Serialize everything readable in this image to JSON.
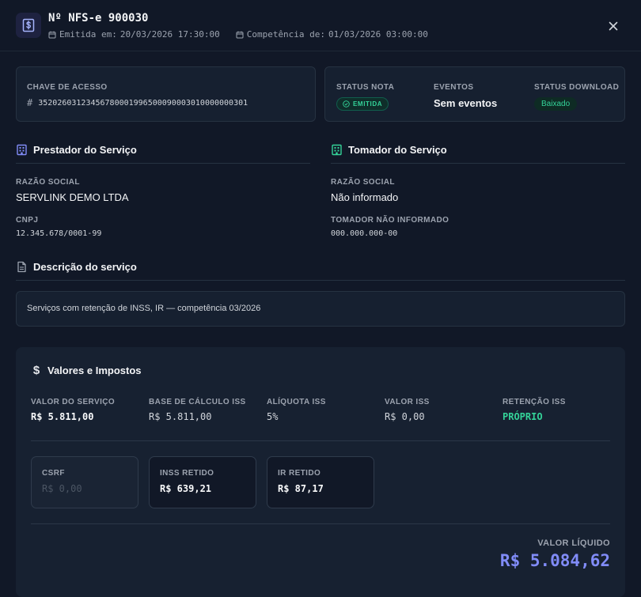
{
  "header": {
    "title": "Nº NFS-e 900030",
    "emitida_label": "Emitida em:",
    "emitida_value": "20/03/2026 17:30:00",
    "competencia_label": "Competência de:",
    "competencia_value": "01/03/2026 03:00:00"
  },
  "access": {
    "label": "CHAVE DE ACESSO",
    "key": "35202603123456780001996500090003010000000301"
  },
  "status": {
    "nota_label": "STATUS NOTA",
    "nota_value": "EMITIDA",
    "eventos_label": "EVENTOS",
    "eventos_value": "Sem eventos",
    "download_label": "STATUS DOWNLOAD",
    "download_value": "Baixado"
  },
  "prestador": {
    "title": "Prestador do Serviço",
    "razao_label": "RAZÃO SOCIAL",
    "razao_value": "SERVLINK DEMO LTDA",
    "cnpj_label": "CNPJ",
    "cnpj_value": "12.345.678/0001-99"
  },
  "tomador": {
    "title": "Tomador do Serviço",
    "razao_label": "RAZÃO SOCIAL",
    "razao_value": "Não informado",
    "doc_label": "TOMADOR NÃO INFORMADO",
    "doc_value": "000.000.000-00"
  },
  "descricao": {
    "title": "Descrição do serviço",
    "text": "Serviços com retenção de INSS, IR — competência 03/2026"
  },
  "valores": {
    "title": "Valores e Impostos",
    "items": [
      {
        "label": "VALOR DO SERVIÇO",
        "value": "R$ 5.811,00"
      },
      {
        "label": "BASE DE CÁLCULO ISS",
        "value": "R$ 5.811,00"
      },
      {
        "label": "ALÍQUOTA ISS",
        "value": "5%"
      },
      {
        "label": "VALOR ISS",
        "value": "R$ 0,00"
      },
      {
        "label": "RETENÇÃO ISS",
        "value": "PRÓPRIO"
      }
    ],
    "taxes": [
      {
        "label": "CSRF",
        "value": "R$ 0,00"
      },
      {
        "label": "INSS RETIDO",
        "value": "R$ 639,21"
      },
      {
        "label": "IR RETIDO",
        "value": "R$ 87,17"
      }
    ],
    "liquido_label": "VALOR LÍQUIDO",
    "liquido_value": "R$ 5.084,62"
  },
  "colors": {
    "accent": "#818cf8",
    "success": "#34d399",
    "background": "#111827"
  }
}
